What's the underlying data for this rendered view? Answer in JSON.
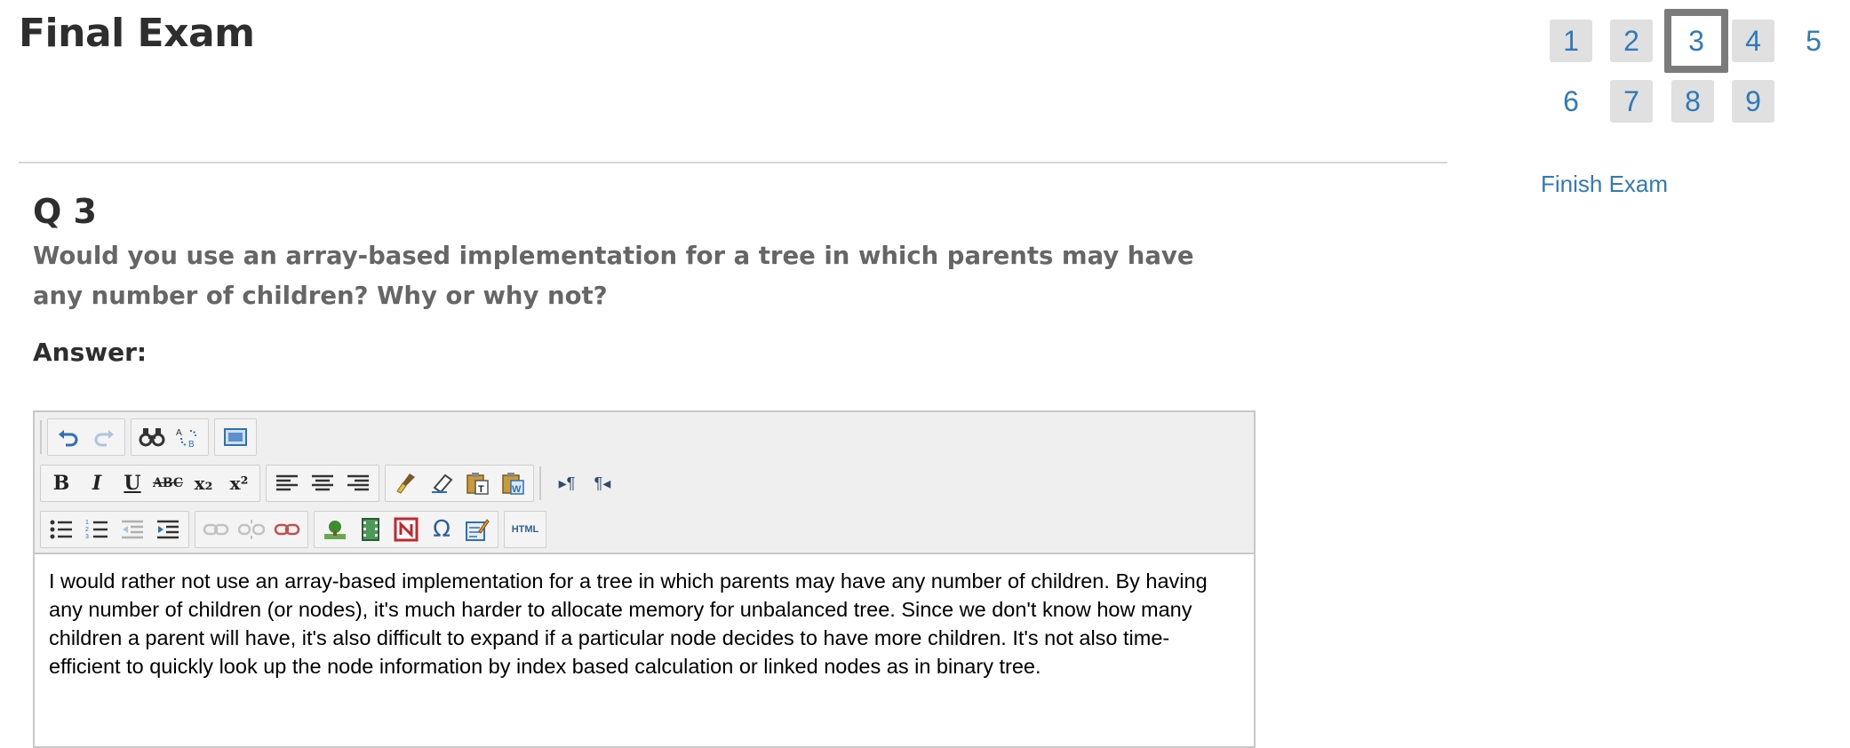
{
  "exam": {
    "title": "Final Exam",
    "finish_label": "Finish Exam"
  },
  "nav": {
    "questions": [
      "1",
      "2",
      "3",
      "4",
      "5",
      "6",
      "7",
      "8",
      "9"
    ],
    "current": "3"
  },
  "question": {
    "label": "Q 3",
    "text": "Would you use an array-based implementation for a tree in which parents may have any number of children? Why or why not?"
  },
  "answer": {
    "label": "Answer:",
    "content": "I would rather not use an array-based implementation for a tree in which parents may have any number of children. By having any number of children (or nodes), it's much harder to allocate memory for unbalanced tree. Since we don't know how many children a parent will have, it's also difficult to expand if a particular node decides to have more children. It's not also time-efficient to quickly look up the node information by index based calculation or linked nodes as in binary tree."
  },
  "editor": {
    "toolbar_rows": [
      [
        "undo-icon",
        "redo-icon",
        "find-icon",
        "replace-icon",
        "fullscreen-icon"
      ],
      [
        "bold-icon",
        "italic-icon",
        "underline-icon",
        "strikethrough-icon",
        "subscript-icon",
        "superscript-icon",
        "align-left-icon",
        "align-center-icon",
        "align-right-icon",
        "cleanup-icon",
        "remove-format-icon",
        "paste-text-icon",
        "paste-word-icon",
        "ltr-icon",
        "rtl-icon"
      ],
      [
        "bullet-list-icon",
        "numbered-list-icon",
        "outdent-icon",
        "indent-icon",
        "link-icon",
        "unlink-icon",
        "anchor-icon",
        "image-icon",
        "media-icon",
        "nonbreaking-icon",
        "special-char-icon",
        "edit-icon",
        "html-icon"
      ]
    ],
    "labels": {
      "bold": "B",
      "italic": "I",
      "underline": "U",
      "strike": "ABC",
      "subscript": "x₂",
      "superscript": "x²",
      "omega": "Ω",
      "html": "HTML"
    }
  },
  "colors": {
    "link": "#2f7ab8",
    "current_border": "#7b7b7b",
    "nav_bg": "#e0e0e0"
  }
}
